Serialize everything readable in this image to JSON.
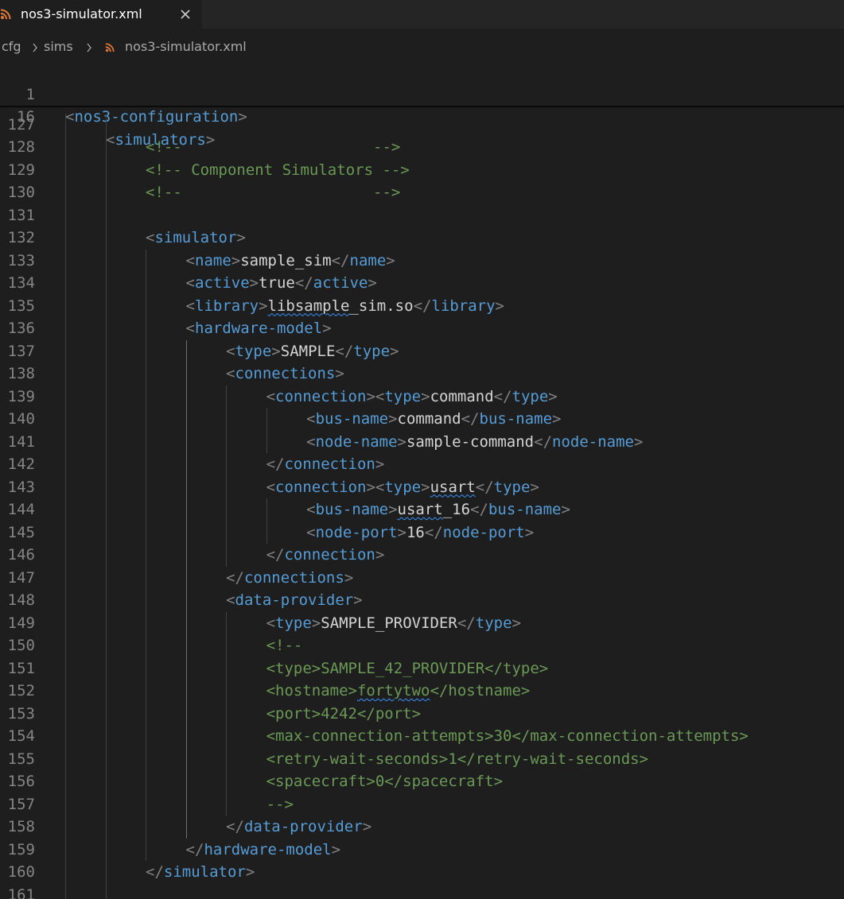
{
  "tab": {
    "title": "nos3-simulator.xml",
    "icon": "rss-icon",
    "close_icon": "close-icon"
  },
  "breadcrumb": {
    "items": [
      "cfg",
      "sims",
      "nos3-simulator.xml"
    ]
  },
  "sticky_scroll": [
    {
      "line": "1",
      "tag": "nos3-configuration"
    },
    {
      "line": "16",
      "tag": "simulators"
    }
  ],
  "colors": {
    "background": "#1e1e1e",
    "tag": "#569cd6",
    "bracket": "#808080",
    "text": "#d4d4d4",
    "comment": "#6a9955",
    "line_number": "#858585"
  },
  "lines": [
    {
      "n": "127"
    },
    {
      "n": "128",
      "comment": "<!--                     -->"
    },
    {
      "n": "129",
      "comment": "<!-- Component Simulators -->"
    },
    {
      "n": "130",
      "comment": "<!--                     -->"
    },
    {
      "n": "131"
    },
    {
      "n": "132",
      "open": "simulator"
    },
    {
      "n": "133",
      "open": "name",
      "value": "sample_sim",
      "close": "name"
    },
    {
      "n": "134",
      "open": "active",
      "value": "true",
      "close": "active"
    },
    {
      "n": "135",
      "open": "library",
      "value": "libsample_sim.so",
      "close": "library"
    },
    {
      "n": "136",
      "open": "hardware-model"
    },
    {
      "n": "137",
      "open": "type",
      "value": "SAMPLE",
      "close": "type"
    },
    {
      "n": "138",
      "open": "connections"
    },
    {
      "n": "139",
      "open": "connection",
      "open2": "type",
      "value": "command",
      "close": "type"
    },
    {
      "n": "140",
      "open": "bus-name",
      "value": "command",
      "close": "bus-name"
    },
    {
      "n": "141",
      "open": "node-name",
      "value": "sample-command",
      "close": "node-name"
    },
    {
      "n": "142",
      "close": "connection"
    },
    {
      "n": "143",
      "open": "connection",
      "open2": "type",
      "value": "usart",
      "close": "type"
    },
    {
      "n": "144",
      "open": "bus-name",
      "value": "usart_16",
      "close": "bus-name"
    },
    {
      "n": "145",
      "open": "node-port",
      "value": "16",
      "close": "node-port"
    },
    {
      "n": "146",
      "close": "connection"
    },
    {
      "n": "147",
      "close": "connections"
    },
    {
      "n": "148",
      "open": "data-provider"
    },
    {
      "n": "149",
      "open": "type",
      "value": "SAMPLE_PROVIDER",
      "close": "type"
    },
    {
      "n": "150",
      "comment": "<!--"
    },
    {
      "n": "151",
      "comment": "<type>SAMPLE_42_PROVIDER</type>"
    },
    {
      "n": "152",
      "comment_pre": "<hostname>",
      "comment_sq": "fortytwo",
      "comment_post": "</hostname>"
    },
    {
      "n": "153",
      "comment": "<port>4242</port>"
    },
    {
      "n": "154",
      "comment": "<max-connection-attempts>30</max-connection-attempts>"
    },
    {
      "n": "155",
      "comment": "<retry-wait-seconds>1</retry-wait-seconds>"
    },
    {
      "n": "156",
      "comment": "<spacecraft>0</spacecraft>"
    },
    {
      "n": "157",
      "comment": "-->"
    },
    {
      "n": "158",
      "close": "data-provider"
    },
    {
      "n": "159",
      "close": "hardware-model"
    },
    {
      "n": "160",
      "close": "simulator"
    },
    {
      "n": "161"
    }
  ]
}
